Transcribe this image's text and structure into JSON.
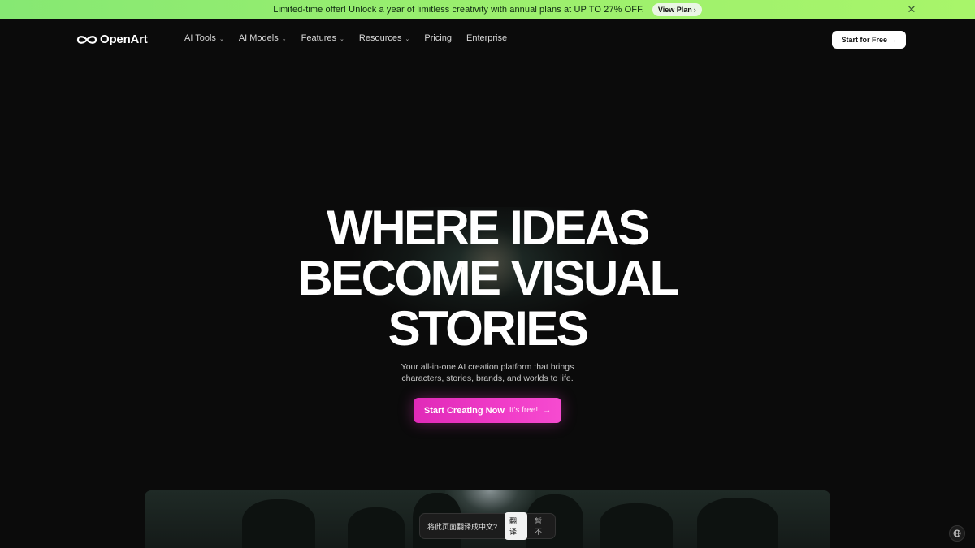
{
  "promo": {
    "text": "Limited-time offer! Unlock a year of limitless creativity with annual plans at UP TO 27% OFF.",
    "button_label": "View Plan",
    "close_icon": "close-icon"
  },
  "header": {
    "logo_text": "OpenArt",
    "nav": [
      {
        "label": "AI Tools",
        "has_dropdown": true
      },
      {
        "label": "AI Models",
        "has_dropdown": true
      },
      {
        "label": "Features",
        "has_dropdown": true
      },
      {
        "label": "Resources",
        "has_dropdown": true
      },
      {
        "label": "Pricing",
        "has_dropdown": false
      },
      {
        "label": "Enterprise",
        "has_dropdown": false
      }
    ],
    "cta_label": "Start for Free"
  },
  "hero": {
    "headline_lines": [
      "WHERE IDEAS",
      "BECOME VISUAL",
      "STORIES"
    ],
    "subtext_line1": "Your all-in-one AI creation platform that brings",
    "subtext_line2": "characters, stories, brands, and worlds to life.",
    "cta_main": "Start Creating Now",
    "cta_sub": "It's free!"
  },
  "translate_prompt": {
    "question": "将此页面翻译成中文?",
    "accept_label": "翻译",
    "dismiss_label": "暂不"
  },
  "colors": {
    "banner_green": "#9bef6e",
    "hero_cta_pink": "#f03cc8",
    "background": "#0b0b0b"
  }
}
